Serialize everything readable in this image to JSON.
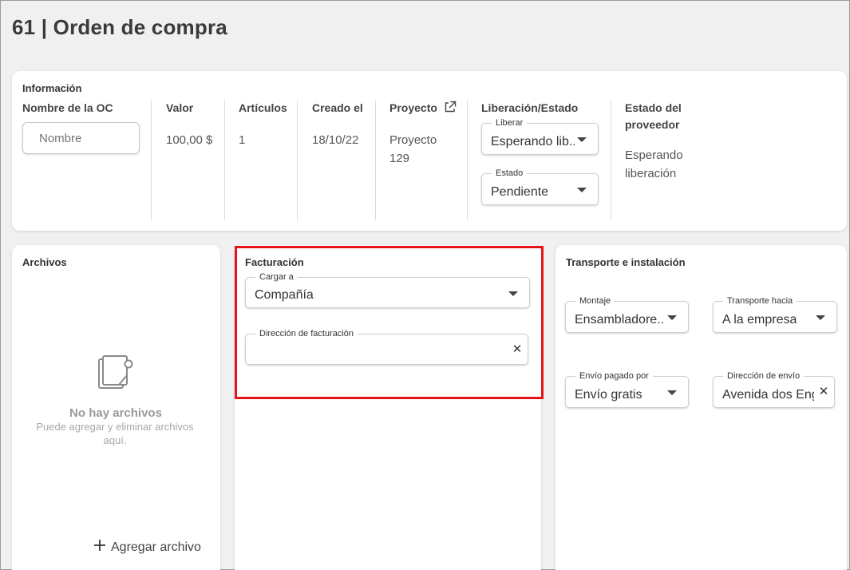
{
  "page": {
    "title": "61 | Orden de compra"
  },
  "info": {
    "section_title": "Información",
    "name": {
      "label": "Nombre de la OC",
      "placeholder": "Nombre"
    },
    "value": {
      "label": "Valor",
      "value": "100,00 $"
    },
    "articles": {
      "label": "Artículos",
      "value": "1"
    },
    "created": {
      "label": "Creado el",
      "value": "18/10/22"
    },
    "project": {
      "label": "Proyecto",
      "value_line1": "Proyecto",
      "value_line2": "129",
      "icon": "external-link-icon"
    },
    "release": {
      "label": "Liberación/Estado",
      "liberar": {
        "label": "Liberar",
        "value": "Esperando lib..."
      },
      "estado": {
        "label": "Estado",
        "value": "Pendiente"
      }
    },
    "supplier": {
      "label_line1": "Estado del",
      "label_line2": "proveedor",
      "value_line1": "Esperando",
      "value_line2": "liberación"
    }
  },
  "files": {
    "title": "Archivos",
    "empty_icon": "document-icon",
    "empty_title": "No hay archivos",
    "empty_sub_line1": "Puede agregar y eliminar archivos",
    "empty_sub_line2": "aquí.",
    "add_label": "Agregar archivo"
  },
  "billing": {
    "title": "Facturación",
    "charge_to": {
      "label": "Cargar a",
      "value": "Compañía"
    },
    "address": {
      "label": "Dirección de facturación",
      "value": ""
    }
  },
  "transport": {
    "title": "Transporte e instalación",
    "assembly": {
      "label": "Montaje",
      "value": "Ensambladore..."
    },
    "transport_to": {
      "label": "Transporte hacia",
      "value": "A la empresa"
    },
    "shipping_paid": {
      "label": "Envío pagado por",
      "value": "Envío gratis"
    },
    "shipping_address": {
      "label": "Dirección de envío",
      "value": "Avenida dos Eng"
    }
  },
  "colors": {
    "highlight": "#e3141a",
    "background": "#f0f0f0",
    "card": "#ffffff"
  }
}
